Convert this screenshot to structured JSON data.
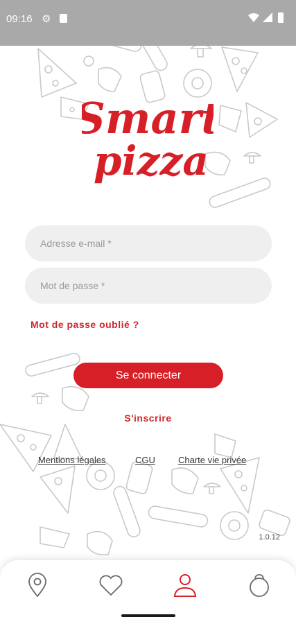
{
  "status_bar": {
    "time": "09:16",
    "icons": [
      "gear-icon",
      "sim-card-icon",
      "wifi-icon",
      "signal-icon",
      "battery-icon"
    ]
  },
  "brand": {
    "logo_line1": "Smart",
    "logo_line2": "pizza",
    "color": "#d61f26"
  },
  "login_form": {
    "email_placeholder": "Adresse e-mail *",
    "password_placeholder": "Mot de passe *",
    "forgot_password": "Mot de passe oublié ?",
    "submit_label": "Se connecter",
    "signup_label": "S'inscrire"
  },
  "legal": {
    "mentions": "Mentions légales",
    "cgu": "CGU",
    "privacy": "Charte vie privée"
  },
  "version": "1.0.12",
  "tab_bar": {
    "tabs": [
      {
        "icon": "location-pin-icon",
        "active": false
      },
      {
        "icon": "heart-icon",
        "active": false
      },
      {
        "icon": "user-icon",
        "active": true
      },
      {
        "icon": "shopping-bag-icon",
        "active": false
      }
    ],
    "active_color": "#d61f26",
    "inactive_color": "#6a6a6a"
  }
}
